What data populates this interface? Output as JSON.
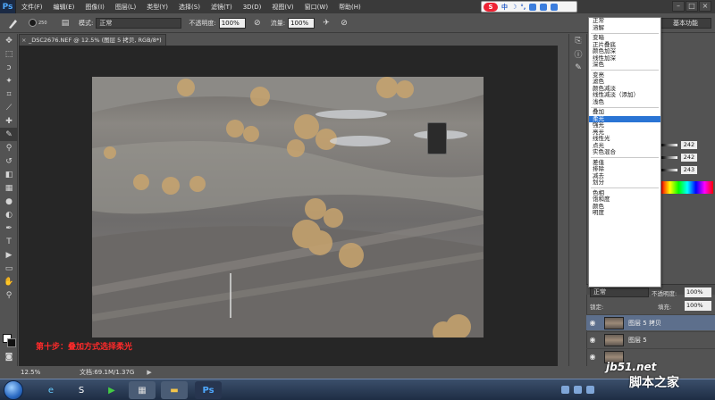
{
  "app": {
    "logo": "Ps",
    "menu": [
      "文件(F)",
      "编辑(E)",
      "图像(I)",
      "图层(L)",
      "类型(Y)",
      "选择(S)",
      "滤镜(T)",
      "3D(D)",
      "视图(V)",
      "窗口(W)",
      "帮助(H)"
    ]
  },
  "ime": {
    "logo": "S",
    "items": [
      "中",
      "☽",
      "°,"
    ]
  },
  "options_bar": {
    "brush_size": "250",
    "mode_label": "模式:",
    "mode_value": "正常",
    "opacity_label": "不透明度:",
    "opacity_value": "100%",
    "flow_label": "流量:",
    "flow_value": "100%",
    "workspace": "基本功能"
  },
  "document": {
    "tab_title": "_DSC2676.NEF @ 12.5% (图层 5 拷贝, RGB/8*)",
    "zoom": "12.5%",
    "doc_info": "文档:69.1M/1.37G"
  },
  "annotation": "第十步：叠加方式选择柔光",
  "blend_dropdown": {
    "groups": [
      [
        "正常",
        "溶解"
      ],
      [
        "变暗",
        "正片叠底",
        "颜色加深",
        "线性加深",
        "深色"
      ],
      [
        "变亮",
        "滤色",
        "颜色减淡",
        "线性减淡（添加）",
        "浅色"
      ],
      [
        "叠加",
        "柔光",
        "强光",
        "亮光",
        "线性光",
        "点光",
        "实色混合"
      ],
      [
        "差值",
        "排除",
        "减去",
        "划分"
      ],
      [
        "色相",
        "饱和度",
        "颜色",
        "明度"
      ]
    ],
    "selected": "柔光"
  },
  "color_panel": {
    "r": "242",
    "g": "242",
    "b": "243"
  },
  "layers_panel": {
    "mode": "正常",
    "opacity_label": "不透明度:",
    "opacity_value": "100%",
    "lock_label": "锁定:",
    "fill_label": "填充:",
    "fill_value": "100%",
    "layers": [
      {
        "name": "图层 5 拷贝",
        "selected": true
      },
      {
        "name": "图层 5",
        "selected": false
      },
      {
        "name": "",
        "selected": false
      }
    ]
  },
  "watermark": {
    "line1": "jb51.net",
    "line2": "脚本之家"
  },
  "colors": {
    "accent": "#2a74d4",
    "annotation": "#ff2a2a",
    "panel": "#535353"
  }
}
